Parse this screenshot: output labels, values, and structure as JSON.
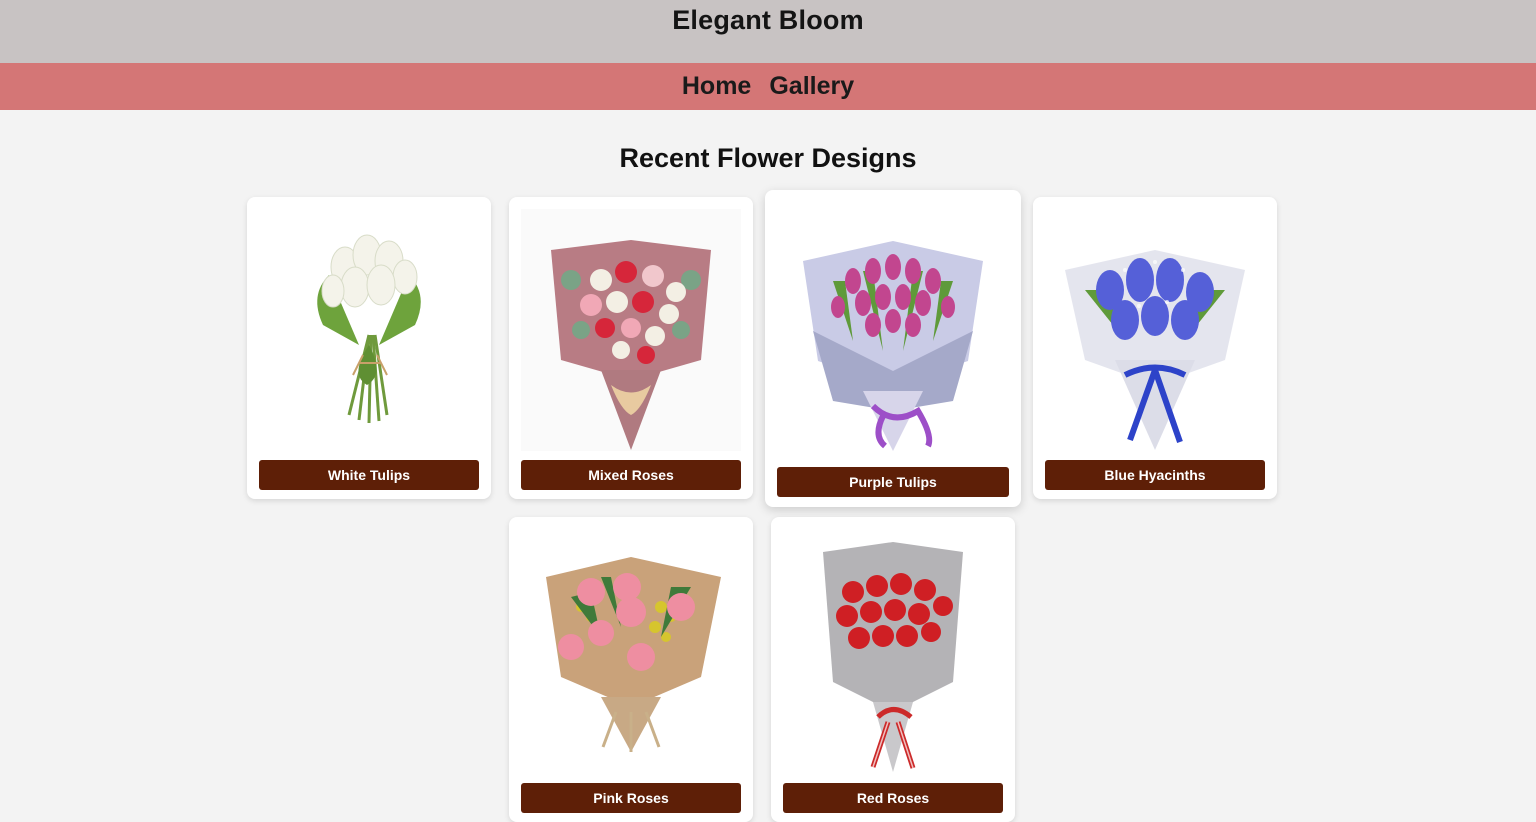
{
  "header": {
    "title": "Elegant Bloom"
  },
  "nav": {
    "items": [
      {
        "label": "Home"
      },
      {
        "label": "Gallery"
      }
    ]
  },
  "main": {
    "section_title": "Recent Flower Designs",
    "cards": [
      {
        "label": "White Tulips",
        "image": "white-tulips-bouquet-image"
      },
      {
        "label": "Mixed Roses",
        "image": "mixed-roses-bouquet-image"
      },
      {
        "label": "Purple Tulips",
        "image": "purple-tulips-bouquet-image"
      },
      {
        "label": "Blue Hyacinths",
        "image": "blue-hyacinths-bouquet-image"
      },
      {
        "label": "Pink Roses",
        "image": "pink-roses-bouquet-image"
      },
      {
        "label": "Red Roses",
        "image": "red-roses-bouquet-image"
      }
    ]
  },
  "colors": {
    "header_bg": "#c8c3c3",
    "nav_bg": "#d47676",
    "page_bg": "#f3f3f3",
    "button_bg": "#5e1f07",
    "button_text": "#ffffff"
  }
}
